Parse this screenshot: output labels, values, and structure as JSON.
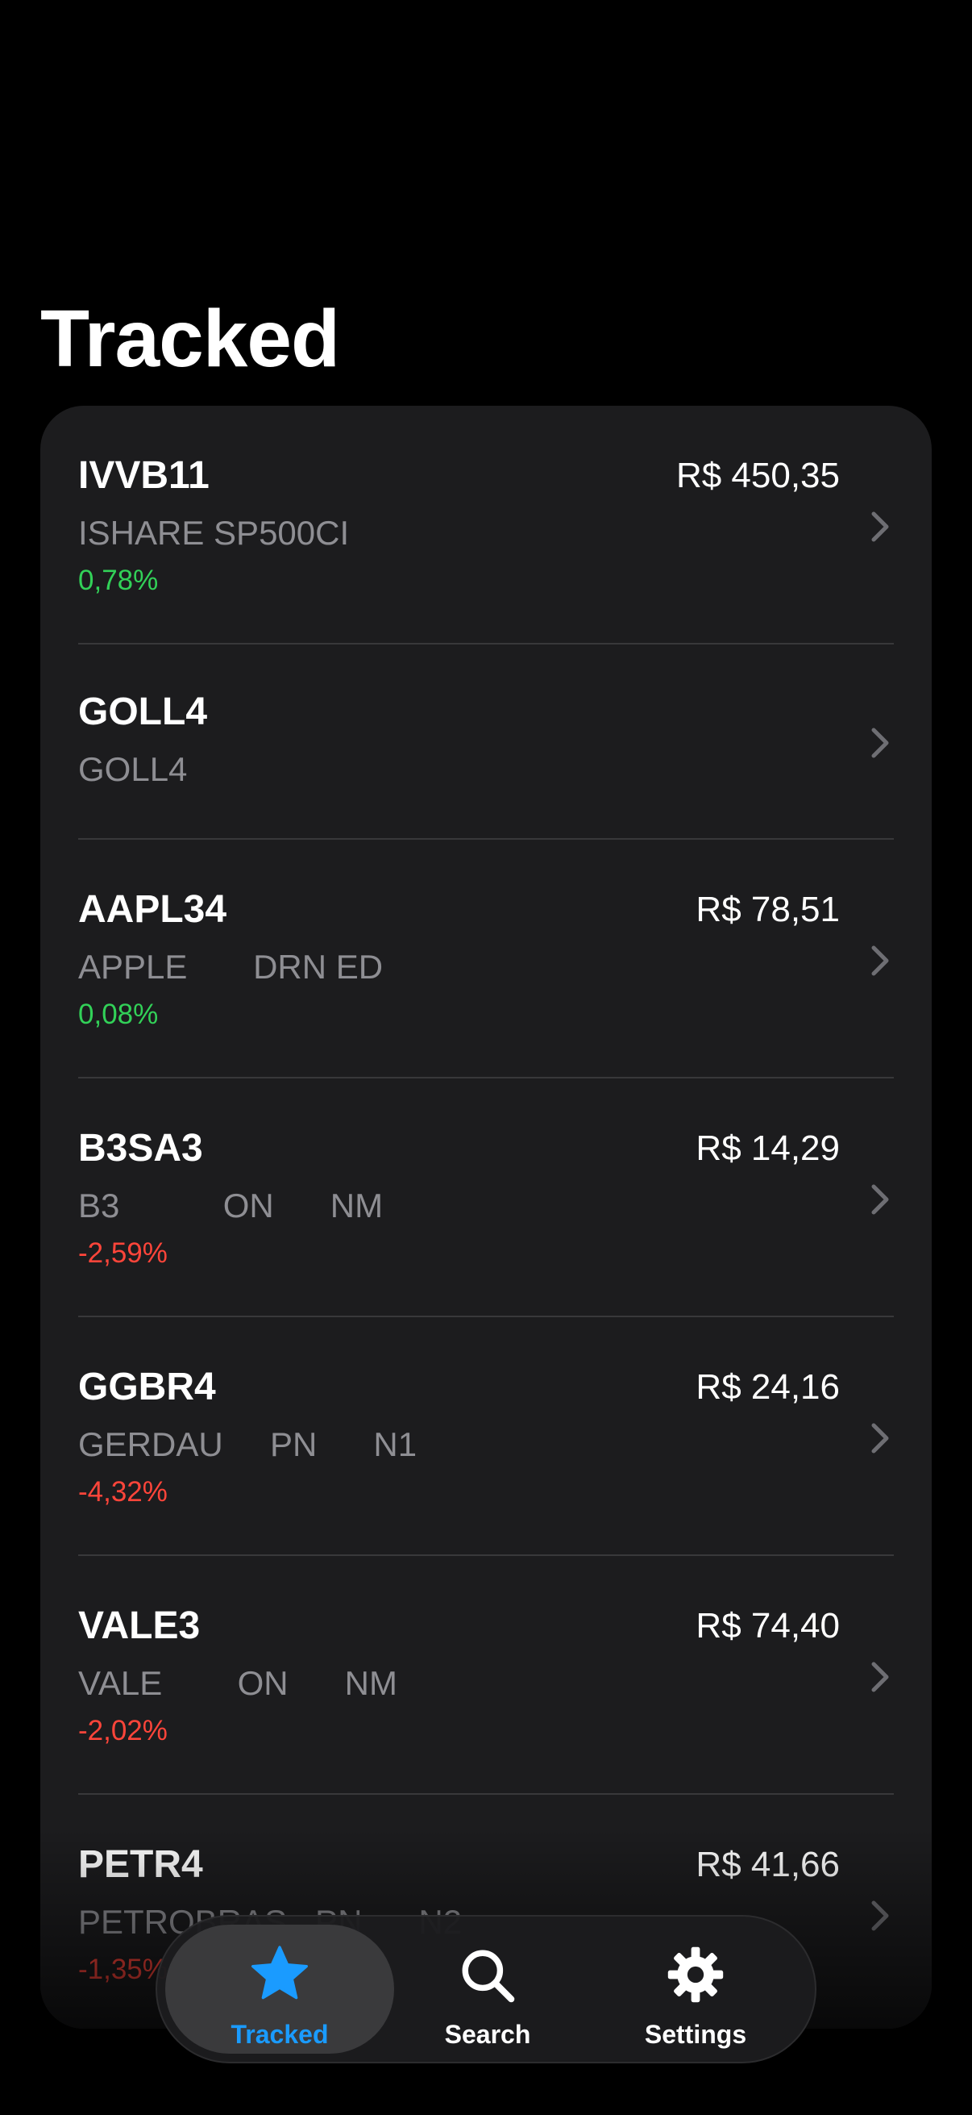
{
  "header": {
    "title": "Tracked"
  },
  "stocks": [
    {
      "symbol": "IVVB11",
      "name": "ISHARE SP500CI",
      "price": "R$ 450,35",
      "change": "0,78%",
      "direction": "up"
    },
    {
      "symbol": "GOLL4",
      "name": "GOLL4",
      "price": "",
      "change": "",
      "direction": ""
    },
    {
      "symbol": "AAPL34",
      "name": "APPLE       DRN ED",
      "price": "R$ 78,51",
      "change": "0,08%",
      "direction": "up"
    },
    {
      "symbol": "B3SA3",
      "name": "B3           ON      NM",
      "price": "R$ 14,29",
      "change": "-2,59%",
      "direction": "down"
    },
    {
      "symbol": "GGBR4",
      "name": "GERDAU     PN      N1",
      "price": "R$ 24,16",
      "change": "-4,32%",
      "direction": "down"
    },
    {
      "symbol": "VALE3",
      "name": "VALE        ON      NM",
      "price": "R$ 74,40",
      "change": "-2,02%",
      "direction": "down"
    },
    {
      "symbol": "PETR4",
      "name": "PETROBRAS   PN      N2",
      "price": "R$ 41,66",
      "change": "-1,35%",
      "direction": "down"
    }
  ],
  "tabbar": {
    "tabs": [
      {
        "label": "Tracked",
        "icon": "star-icon",
        "active": true
      },
      {
        "label": "Search",
        "icon": "search-icon",
        "active": false
      },
      {
        "label": "Settings",
        "icon": "gear-icon",
        "active": false
      }
    ]
  },
  "colors": {
    "background": "#000000",
    "card": "#1c1c1e",
    "positive": "#32d158",
    "negative": "#ff453a",
    "accent": "#1a9bff"
  }
}
